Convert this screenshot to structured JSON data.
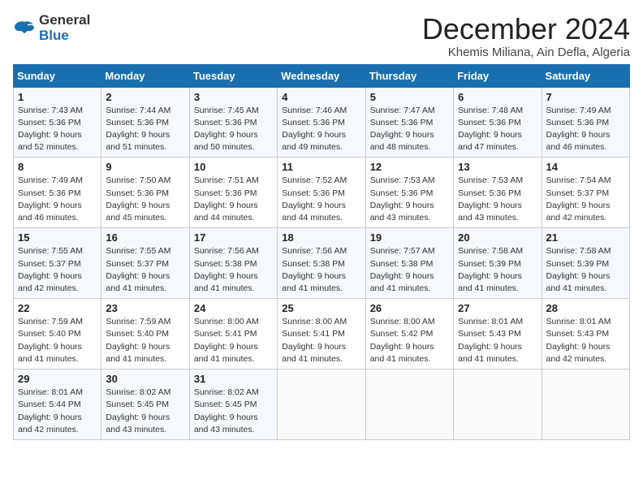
{
  "header": {
    "logo_line1": "General",
    "logo_line2": "Blue",
    "title": "December 2024",
    "subtitle": "Khemis Miliana, Ain Defla, Algeria"
  },
  "weekdays": [
    "Sunday",
    "Monday",
    "Tuesday",
    "Wednesday",
    "Thursday",
    "Friday",
    "Saturday"
  ],
  "weeks": [
    [
      {
        "day": "1",
        "sunrise": "7:43 AM",
        "sunset": "5:36 PM",
        "daylight": "9 hours and 52 minutes."
      },
      {
        "day": "2",
        "sunrise": "7:44 AM",
        "sunset": "5:36 PM",
        "daylight": "9 hours and 51 minutes."
      },
      {
        "day": "3",
        "sunrise": "7:45 AM",
        "sunset": "5:36 PM",
        "daylight": "9 hours and 50 minutes."
      },
      {
        "day": "4",
        "sunrise": "7:46 AM",
        "sunset": "5:36 PM",
        "daylight": "9 hours and 49 minutes."
      },
      {
        "day": "5",
        "sunrise": "7:47 AM",
        "sunset": "5:36 PM",
        "daylight": "9 hours and 48 minutes."
      },
      {
        "day": "6",
        "sunrise": "7:48 AM",
        "sunset": "5:36 PM",
        "daylight": "9 hours and 47 minutes."
      },
      {
        "day": "7",
        "sunrise": "7:49 AM",
        "sunset": "5:36 PM",
        "daylight": "9 hours and 46 minutes."
      }
    ],
    [
      {
        "day": "8",
        "sunrise": "7:49 AM",
        "sunset": "5:36 PM",
        "daylight": "9 hours and 46 minutes."
      },
      {
        "day": "9",
        "sunrise": "7:50 AM",
        "sunset": "5:36 PM",
        "daylight": "9 hours and 45 minutes."
      },
      {
        "day": "10",
        "sunrise": "7:51 AM",
        "sunset": "5:36 PM",
        "daylight": "9 hours and 44 minutes."
      },
      {
        "day": "11",
        "sunrise": "7:52 AM",
        "sunset": "5:36 PM",
        "daylight": "9 hours and 44 minutes."
      },
      {
        "day": "12",
        "sunrise": "7:53 AM",
        "sunset": "5:36 PM",
        "daylight": "9 hours and 43 minutes."
      },
      {
        "day": "13",
        "sunrise": "7:53 AM",
        "sunset": "5:36 PM",
        "daylight": "9 hours and 43 minutes."
      },
      {
        "day": "14",
        "sunrise": "7:54 AM",
        "sunset": "5:37 PM",
        "daylight": "9 hours and 42 minutes."
      }
    ],
    [
      {
        "day": "15",
        "sunrise": "7:55 AM",
        "sunset": "5:37 PM",
        "daylight": "9 hours and 42 minutes."
      },
      {
        "day": "16",
        "sunrise": "7:55 AM",
        "sunset": "5:37 PM",
        "daylight": "9 hours and 41 minutes."
      },
      {
        "day": "17",
        "sunrise": "7:56 AM",
        "sunset": "5:38 PM",
        "daylight": "9 hours and 41 minutes."
      },
      {
        "day": "18",
        "sunrise": "7:56 AM",
        "sunset": "5:38 PM",
        "daylight": "9 hours and 41 minutes."
      },
      {
        "day": "19",
        "sunrise": "7:57 AM",
        "sunset": "5:38 PM",
        "daylight": "9 hours and 41 minutes."
      },
      {
        "day": "20",
        "sunrise": "7:58 AM",
        "sunset": "5:39 PM",
        "daylight": "9 hours and 41 minutes."
      },
      {
        "day": "21",
        "sunrise": "7:58 AM",
        "sunset": "5:39 PM",
        "daylight": "9 hours and 41 minutes."
      }
    ],
    [
      {
        "day": "22",
        "sunrise": "7:59 AM",
        "sunset": "5:40 PM",
        "daylight": "9 hours and 41 minutes."
      },
      {
        "day": "23",
        "sunrise": "7:59 AM",
        "sunset": "5:40 PM",
        "daylight": "9 hours and 41 minutes."
      },
      {
        "day": "24",
        "sunrise": "8:00 AM",
        "sunset": "5:41 PM",
        "daylight": "9 hours and 41 minutes."
      },
      {
        "day": "25",
        "sunrise": "8:00 AM",
        "sunset": "5:41 PM",
        "daylight": "9 hours and 41 minutes."
      },
      {
        "day": "26",
        "sunrise": "8:00 AM",
        "sunset": "5:42 PM",
        "daylight": "9 hours and 41 minutes."
      },
      {
        "day": "27",
        "sunrise": "8:01 AM",
        "sunset": "5:43 PM",
        "daylight": "9 hours and 41 minutes."
      },
      {
        "day": "28",
        "sunrise": "8:01 AM",
        "sunset": "5:43 PM",
        "daylight": "9 hours and 42 minutes."
      }
    ],
    [
      {
        "day": "29",
        "sunrise": "8:01 AM",
        "sunset": "5:44 PM",
        "daylight": "9 hours and 42 minutes."
      },
      {
        "day": "30",
        "sunrise": "8:02 AM",
        "sunset": "5:45 PM",
        "daylight": "9 hours and 43 minutes."
      },
      {
        "day": "31",
        "sunrise": "8:02 AM",
        "sunset": "5:45 PM",
        "daylight": "9 hours and 43 minutes."
      },
      null,
      null,
      null,
      null
    ]
  ]
}
